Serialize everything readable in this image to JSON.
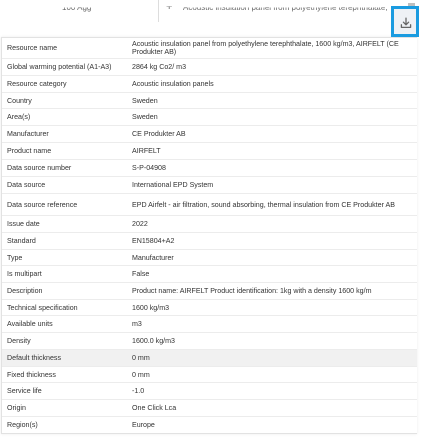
{
  "background": {
    "left_text": "100 Agg",
    "right_text": "Acoustic insulation panel from polyethylene terephthalate,"
  },
  "download_button": {
    "icon": "download-icon",
    "accent": "#1a9be0"
  },
  "details": [
    {
      "label": "Resource name",
      "value": "Acoustic insulation panel from polyethylene terephthalate, 1600 kg/m3, AIRFELT (CE Produkter AB)"
    },
    {
      "label": "Global warming potential (A1-A3)",
      "value": "2864 kg Co2/ m3"
    },
    {
      "label": "Resource category",
      "value": "Acoustic insulation panels"
    },
    {
      "label": "Country",
      "value": "Sweden"
    },
    {
      "label": "Area(s)",
      "value": "Sweden"
    },
    {
      "label": "Manufacturer",
      "value": "CE Produkter AB"
    },
    {
      "label": "Product name",
      "value": "AIRFELT"
    },
    {
      "label": "Data source number",
      "value": "S-P-04908"
    },
    {
      "label": "Data source",
      "value": "International EPD System"
    },
    {
      "label": "Data source reference",
      "value": "EPD Airfelt - air filtration, sound absorbing, thermal insulation from CE Produkter AB"
    },
    {
      "label": "Issue date",
      "value": "2022"
    },
    {
      "label": "Standard",
      "value": "EN15804+A2"
    },
    {
      "label": "Type",
      "value": "Manufacturer"
    },
    {
      "label": "Is multipart",
      "value": "False"
    },
    {
      "label": "Description",
      "value": "Product name: AIRFELT Product identification: 1kg with a density 1600 kg/m"
    },
    {
      "label": "Technical specification",
      "value": "1600 kg/m3"
    },
    {
      "label": "Available units",
      "value": "m3"
    },
    {
      "label": "Density",
      "value": "1600.0 kg/m3"
    },
    {
      "label": "Default thickness",
      "value": "0 mm",
      "highlighted": true
    },
    {
      "label": "Fixed thickness",
      "value": "0 mm"
    },
    {
      "label": "Service life",
      "value": "-1.0"
    },
    {
      "label": "Origin",
      "value": "One Click Lca"
    },
    {
      "label": "Region(s)",
      "value": "Europe"
    }
  ]
}
